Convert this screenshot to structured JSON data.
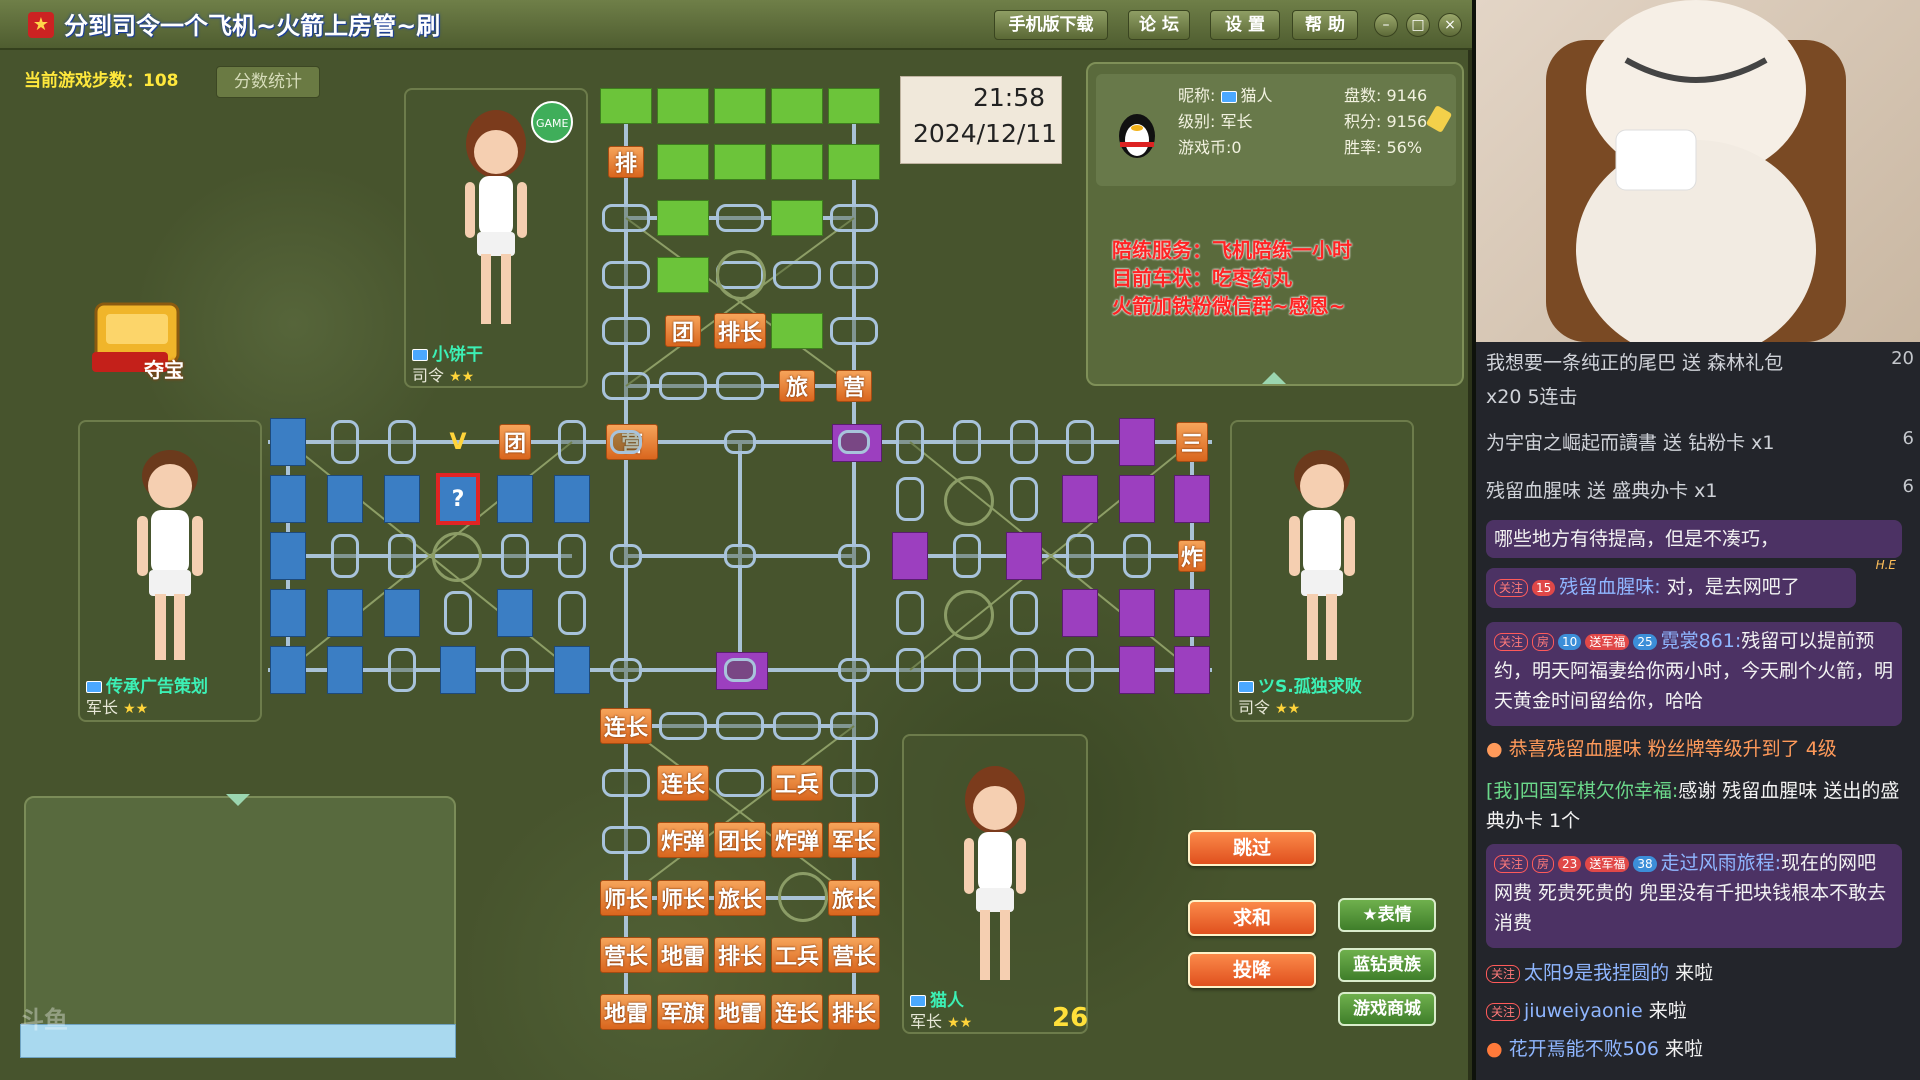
{
  "window": {
    "title": "分到司令一个飞机~火箭上房管~刷",
    "buttons": [
      "手机版下载",
      "论 坛",
      "设 置",
      "帮 助"
    ],
    "min": "–",
    "max": "□",
    "close": "×"
  },
  "status": {
    "steps_label": "当前游戏步数：108",
    "score_button": "分数统计"
  },
  "clock": {
    "time": "21:58",
    "date": "2024/12/11"
  },
  "self_info": {
    "nick_label": "昵称:",
    "nick": "猫人",
    "level_label": "级别:",
    "level": "军长",
    "coins": "游戏币:0",
    "games": "盘数: 9146",
    "points": "积分: 9156",
    "winrate": "胜率: 56%"
  },
  "notices": [
    "陪练服务：飞机陪练一小时",
    "目前车状：吃枣药丸",
    "火箭加铁粉微信群~感恩~"
  ],
  "players": {
    "top": {
      "name": "小饼干",
      "rank": "司令"
    },
    "left": {
      "name": "传承广告策划",
      "rank": "军长"
    },
    "right": {
      "name": "ツS.孤独求败",
      "rank": "司令"
    },
    "bottom": {
      "name": "猫人",
      "rank": "军长",
      "timer": "26"
    }
  },
  "treasure": {
    "label": "夺宝"
  },
  "board": {
    "orange_pieces": [
      [
        "连长",
        "",
        "",
        "",
        ""
      ],
      [
        "",
        "连长",
        "",
        "工兵",
        ""
      ],
      [
        "",
        "炸弹",
        "团长",
        "炸弹",
        "军长"
      ],
      [
        "师长",
        "师长",
        "旅长",
        "",
        "旅长"
      ],
      [
        "营长",
        "地雷",
        "排长",
        "工兵",
        "营长"
      ],
      [
        "地雷",
        "军旗",
        "地雷",
        "连长",
        "排长"
      ]
    ],
    "revealed_small": {
      "pai": "排",
      "tuan_top": "团",
      "lv": "旅",
      "ying_top": "营",
      "ying_mid": "营",
      "tuan_left": "团",
      "zha_right": "炸",
      "question": "?",
      "v_mark": "V",
      "san": "三"
    }
  },
  "actions": {
    "skip": "跳过",
    "draw": "求和",
    "surrender": "投降",
    "emote": "表情",
    "blue_vip": "蓝钻贵族",
    "shop": "游戏商城"
  },
  "watermark": "斗鱼",
  "stream": {
    "gifts": [
      {
        "text": "我想要一条纯正的尾巴 送 森林礼包",
        "count": "20"
      },
      {
        "text": "x20 5连击",
        "count": ""
      },
      {
        "text": "为宇宙之崛起而讀書 送 钻粉卡 x1",
        "count": "6"
      },
      {
        "text": "残留血腥味 送 盛典办卡 x1",
        "count": "6"
      }
    ],
    "messages": [
      {
        "user": "",
        "text": "哪些地方有待提高，但是不凑巧，"
      },
      {
        "user": "残留血腥味:",
        "text": "对，是去网吧了"
      },
      {
        "user": "霓裳861:",
        "text": "残留可以提前预约，明天阿福妻给你两小时，今天刷个火箭，明天黄金时间留给你，哈哈"
      },
      {
        "user": "",
        "text": "恭喜残留血腥味 粉丝牌等级升到了 4级"
      },
      {
        "user": "[我]四国军棋欠你幸福:",
        "text": "感谢 残留血腥味 送出的盛典办卡 1个"
      },
      {
        "user": "走过风雨旅程:",
        "text": "现在的网吧 网费 死贵死贵的 兜里没有千把块钱根本不敢去消费"
      },
      {
        "user": "太阳9是我捏圆的",
        "text": "来啦"
      },
      {
        "user": "jiuweiyaonie",
        "text": "来啦"
      },
      {
        "user": "花开焉能不败506",
        "text": "来啦"
      }
    ],
    "badges": {
      "follow": "关注",
      "fan15": "15",
      "lv10": "10",
      "car": "送军福",
      "lv25": "25",
      "lv23": "23",
      "lv38": "38",
      "room": "房",
      "he": "H.E"
    }
  }
}
